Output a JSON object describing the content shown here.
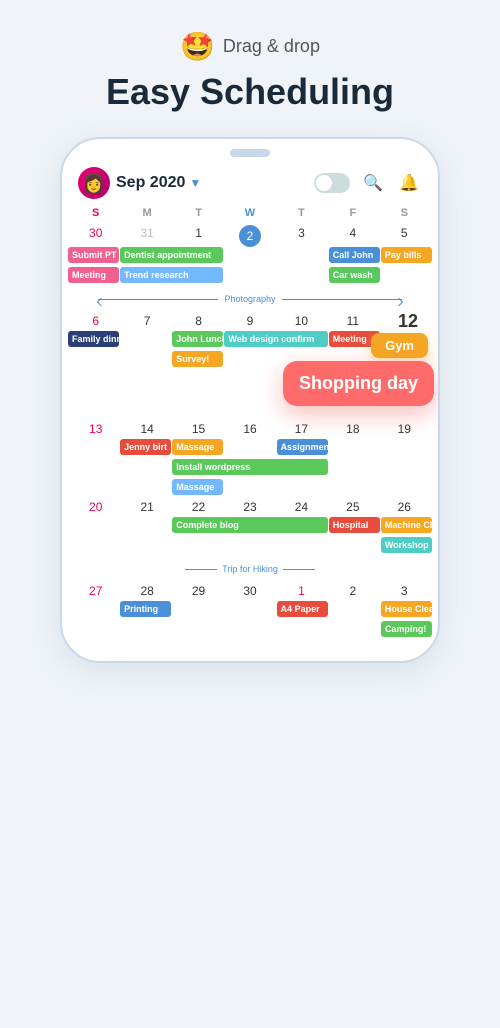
{
  "header": {
    "emoji": "🤩",
    "drag_drop_text": "Drag & drop",
    "title": "Easy Scheduling"
  },
  "calendar": {
    "month": "Sep 2020",
    "day_headers": [
      "S",
      "M",
      "T",
      "W",
      "T",
      "F",
      "S"
    ],
    "week1": {
      "dates": [
        "30",
        "31",
        "1",
        "2",
        "3",
        "4",
        "5"
      ],
      "events": [
        {
          "label": "Submit PT",
          "col_start": 1,
          "col_span": 1,
          "color": "pink"
        },
        {
          "label": "Meeting",
          "col_start": 1,
          "col_span": 1,
          "color": "pink"
        },
        {
          "label": "Dentist appointment",
          "col_start": 2,
          "col_span": 2,
          "color": "green"
        },
        {
          "label": "Trend research",
          "col_start": 2,
          "col_span": 2,
          "color": "lightblue"
        },
        {
          "label": "Call John",
          "col_start": 6,
          "col_span": 1,
          "color": "blue"
        },
        {
          "label": "Pay bills",
          "col_start": 7,
          "col_span": 1,
          "color": "orange"
        },
        {
          "label": "Car wash",
          "col_start": 6,
          "col_span": 1,
          "color": "green"
        }
      ]
    },
    "week2": {
      "dates": [
        "6",
        "7",
        "8",
        "9",
        "10",
        "11",
        ""
      ],
      "events": [
        {
          "label": "Family dinn",
          "col_start": 1,
          "col_span": 1,
          "color": "darkblue"
        },
        {
          "label": "John Lunch",
          "col_start": 3,
          "col_span": 1,
          "color": "green"
        },
        {
          "label": "Survey!",
          "col_start": 3,
          "col_span": 1,
          "color": "orange"
        },
        {
          "label": "Web design confirm",
          "col_start": 4,
          "col_span": 2,
          "color": "teal"
        },
        {
          "label": "Meeting",
          "col_start": 6,
          "col_span": 1,
          "color": "red"
        }
      ]
    },
    "week3": {
      "dates": [
        "13",
        "14",
        "15",
        "16",
        "17",
        "18",
        "19"
      ],
      "events": [
        {
          "label": "Jenny birt",
          "col_start": 2,
          "col_span": 1,
          "color": "red"
        },
        {
          "label": "Massage",
          "col_start": 3,
          "col_span": 1,
          "color": "orange"
        },
        {
          "label": "Assignmen",
          "col_start": 5,
          "col_span": 1,
          "color": "blue"
        },
        {
          "label": "Install wordpress",
          "col_start": 3,
          "col_span": 3,
          "color": "green"
        },
        {
          "label": "Massage",
          "col_start": 3,
          "col_span": 1,
          "color": "lightblue"
        }
      ]
    },
    "week4": {
      "dates": [
        "20",
        "21",
        "22",
        "23",
        "24",
        "25",
        "26"
      ],
      "events": [
        {
          "label": "Complete blog",
          "col_start": 3,
          "col_span": 3,
          "color": "green"
        },
        {
          "label": "Hospital",
          "col_start": 6,
          "col_span": 1,
          "color": "red"
        },
        {
          "label": "Machine Cl",
          "col_start": 7,
          "col_span": 1,
          "color": "orange"
        },
        {
          "label": "Workshop",
          "col_start": 7,
          "col_span": 1,
          "color": "teal"
        }
      ]
    },
    "week5": {
      "dates": [
        "27",
        "28",
        "29",
        "30",
        "1",
        "2",
        "3"
      ],
      "events": [
        {
          "label": "Printing",
          "col_start": 2,
          "col_span": 1,
          "color": "blue"
        },
        {
          "label": "A4 Paper",
          "col_start": 5,
          "col_span": 1,
          "color": "red"
        },
        {
          "label": "House Clea",
          "col_start": 7,
          "col_span": 1,
          "color": "orange"
        },
        {
          "label": "Camping!",
          "col_start": 7,
          "col_span": 1,
          "color": "green"
        }
      ]
    },
    "photography_label": "Photography",
    "trip_label": "Trip for Hiking",
    "float_12": "12",
    "float_gym": "Gym",
    "float_shopping": "Shopping day"
  }
}
